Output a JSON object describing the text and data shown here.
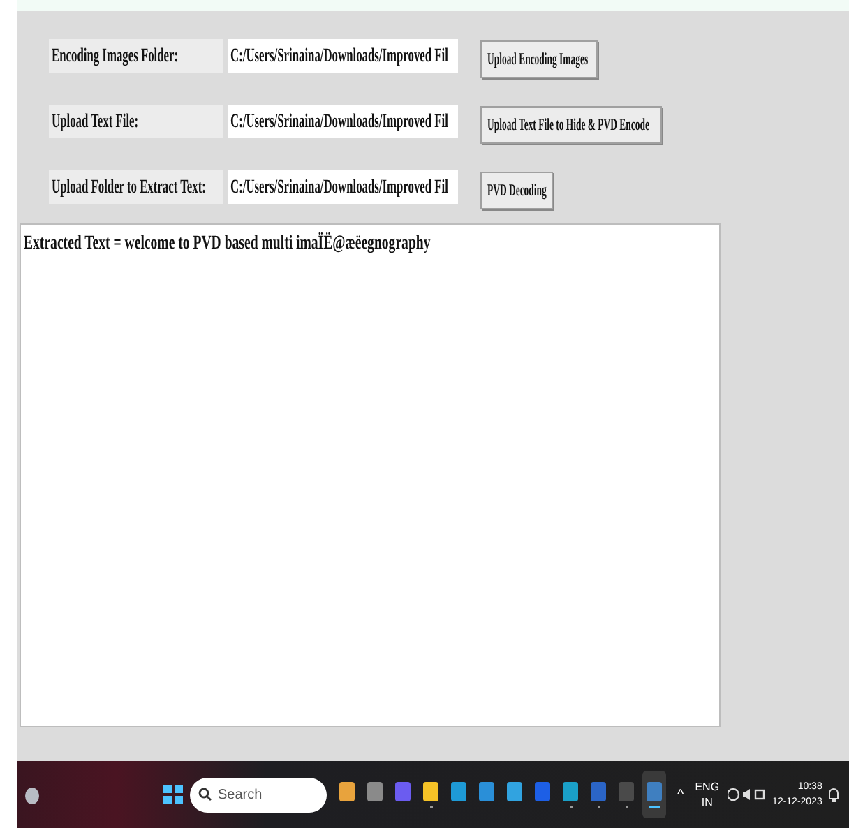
{
  "rows": [
    {
      "label": "Encoding Images Folder:",
      "value": "C:/Users/Srinaina/Downloads/Improved Fil",
      "button": "Upload Encoding Images"
    },
    {
      "label": "Upload Text File:",
      "value": "C:/Users/Srinaina/Downloads/Improved Fil",
      "button": "Upload Text File to Hide & PVD Encode"
    },
    {
      "label": "Upload Folder to Extract Text:",
      "value": "C:/Users/Srinaina/Downloads/Improved Fil",
      "button": "PVD Decoding"
    }
  ],
  "output": "Extracted Text =  welcome to PVD based multi imaÏË@æëegnography",
  "taskbar": {
    "search_placeholder": "Search",
    "apps": [
      {
        "color": "#e8a33d",
        "running": false,
        "selected": false
      },
      {
        "color": "#8a8a8a",
        "running": false,
        "selected": false
      },
      {
        "color": "#6b5cf0",
        "running": false,
        "selected": false
      },
      {
        "color": "#f5c227",
        "running": true,
        "selected": false
      },
      {
        "color": "#1e9ad6",
        "running": false,
        "selected": false
      },
      {
        "color": "#2a8fd8",
        "running": false,
        "selected": false
      },
      {
        "color": "#31a3e0",
        "running": false,
        "selected": false
      },
      {
        "color": "#1d5fe6",
        "running": false,
        "selected": false
      },
      {
        "color": "#1aa0c8",
        "running": true,
        "selected": false
      },
      {
        "color": "#2b65c7",
        "running": true,
        "selected": false
      },
      {
        "color": "#4a4a4a",
        "running": true,
        "selected": false
      },
      {
        "color": "#3f7fc0",
        "running": true,
        "selected": true
      }
    ],
    "overflow_caret": "^",
    "lang": "ENG",
    "region": "IN",
    "time": "10:38",
    "date": "12-12-2023"
  }
}
